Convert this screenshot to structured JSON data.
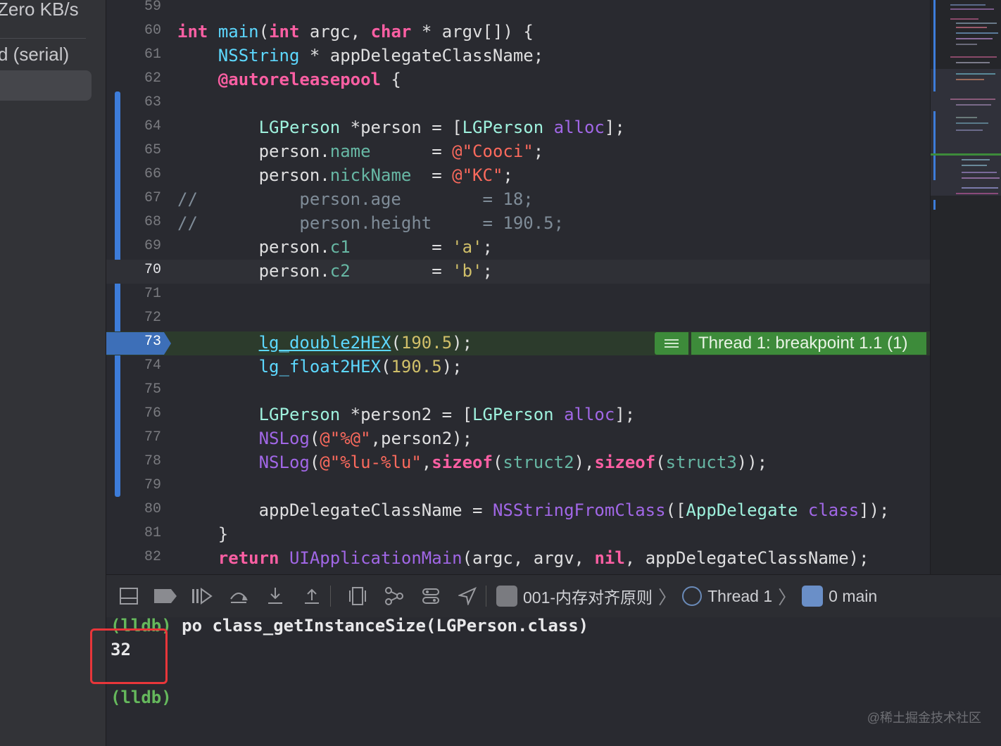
{
  "sidebar": {
    "network_rate": "Zero KB/s",
    "queue_label": "d (serial)"
  },
  "editor": {
    "breakpoint_banner": "Thread 1: breakpoint 1.1 (1)",
    "current_line": "70",
    "breakpoint_line": "73",
    "lines": [
      {
        "n": "59"
      },
      {
        "n": "60"
      },
      {
        "n": "61"
      },
      {
        "n": "62"
      },
      {
        "n": "63"
      },
      {
        "n": "64"
      },
      {
        "n": "65"
      },
      {
        "n": "66"
      },
      {
        "n": "67"
      },
      {
        "n": "68"
      },
      {
        "n": "69"
      },
      {
        "n": "70"
      },
      {
        "n": "71"
      },
      {
        "n": "72"
      },
      {
        "n": "73"
      },
      {
        "n": "74"
      },
      {
        "n": "75"
      },
      {
        "n": "76"
      },
      {
        "n": "77"
      },
      {
        "n": "78"
      },
      {
        "n": "79"
      },
      {
        "n": "80"
      },
      {
        "n": "81"
      },
      {
        "n": "82"
      }
    ]
  },
  "debug_bar": {
    "target": "001-内存对齐原则",
    "thread": "Thread 1",
    "frame": "0 main"
  },
  "console": {
    "prompt": "(lldb)",
    "command": " po class_getInstanceSize(LGPerson.class)",
    "output": "32"
  },
  "watermark": "@稀土掘金技术社区",
  "colors": {
    "accent_change_bar": "#3d7cd9",
    "breakpoint_green": "#3d8b3a",
    "highlight_box": "#e8363a",
    "prompt_green": "#65b85c"
  }
}
